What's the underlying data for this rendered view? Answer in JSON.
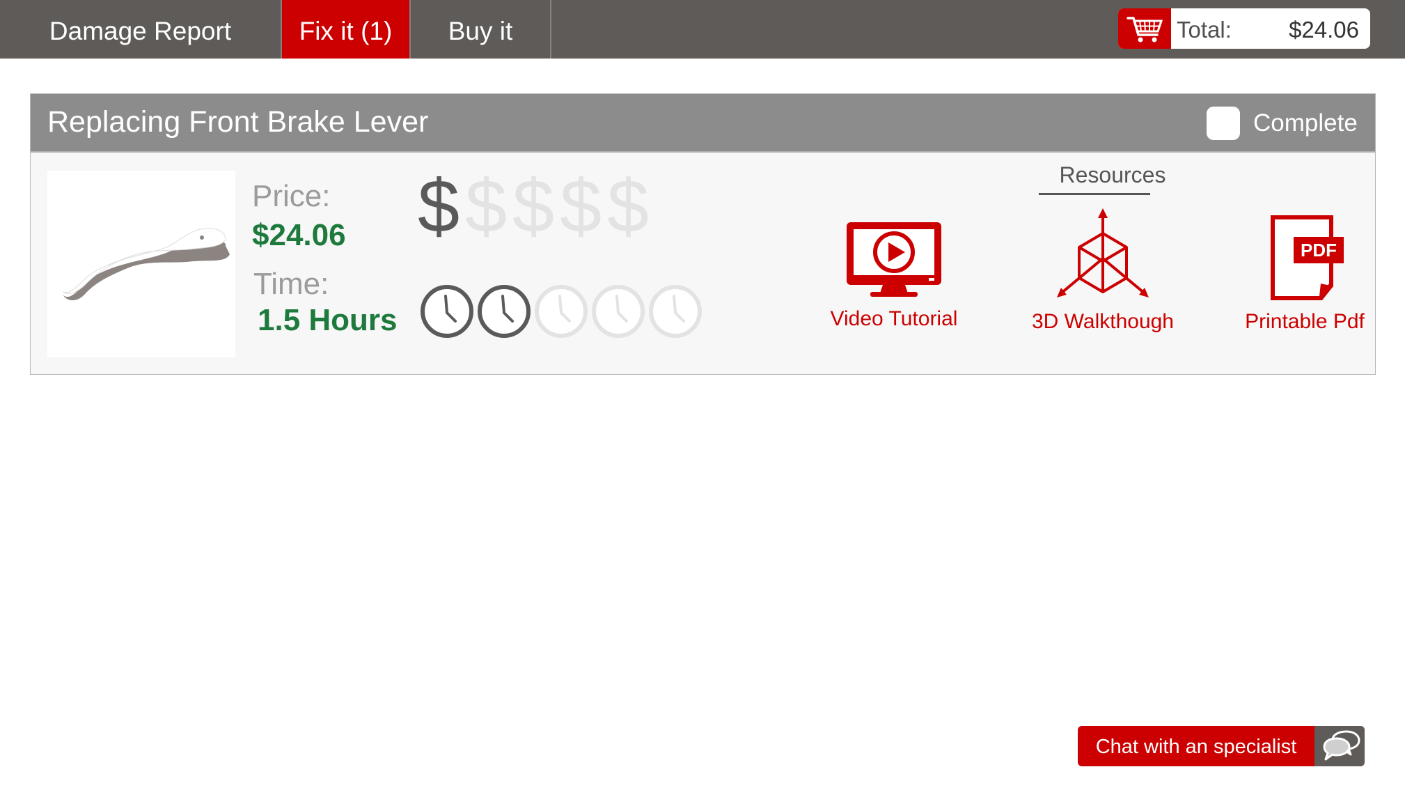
{
  "nav": {
    "tabs": [
      {
        "label": "Damage Report",
        "active": false
      },
      {
        "label": "Fix it (1)",
        "active": true
      },
      {
        "label": "Buy it",
        "active": false
      }
    ],
    "cart": {
      "icon": "shopping-cart-icon",
      "total_label": "Total:",
      "total_value": "$24.06"
    }
  },
  "task": {
    "title": "Replacing Front Brake Lever",
    "complete_label": "Complete",
    "complete_checked": false,
    "part_image_icon": "brake-lever-image",
    "price_label": "Price:",
    "price_value": "$24.06",
    "time_label": "Time:",
    "time_value": "1.5 Hours",
    "cost_rating": {
      "symbol": "$",
      "filled": 1,
      "max": 5
    },
    "time_rating": {
      "filled": 2,
      "max": 5
    },
    "resources_title": "Resources",
    "resources": [
      {
        "label": "Video Tutorial",
        "icon": "video-monitor-icon"
      },
      {
        "label": "3D Walkthough",
        "icon": "3d-cube-icon"
      },
      {
        "label": "Printable Pdf",
        "icon": "pdf-document-icon"
      }
    ]
  },
  "chat": {
    "label": "Chat with an specialist",
    "icon": "chat-bubbles-icon"
  },
  "colors": {
    "accent_red": "#cc0000",
    "nav_bg": "#5e5b59",
    "header_gray": "#8c8c8c",
    "value_green": "#1e7a3c",
    "rating_filled": "#5a5a5a",
    "rating_empty": "#e3e3e3"
  }
}
